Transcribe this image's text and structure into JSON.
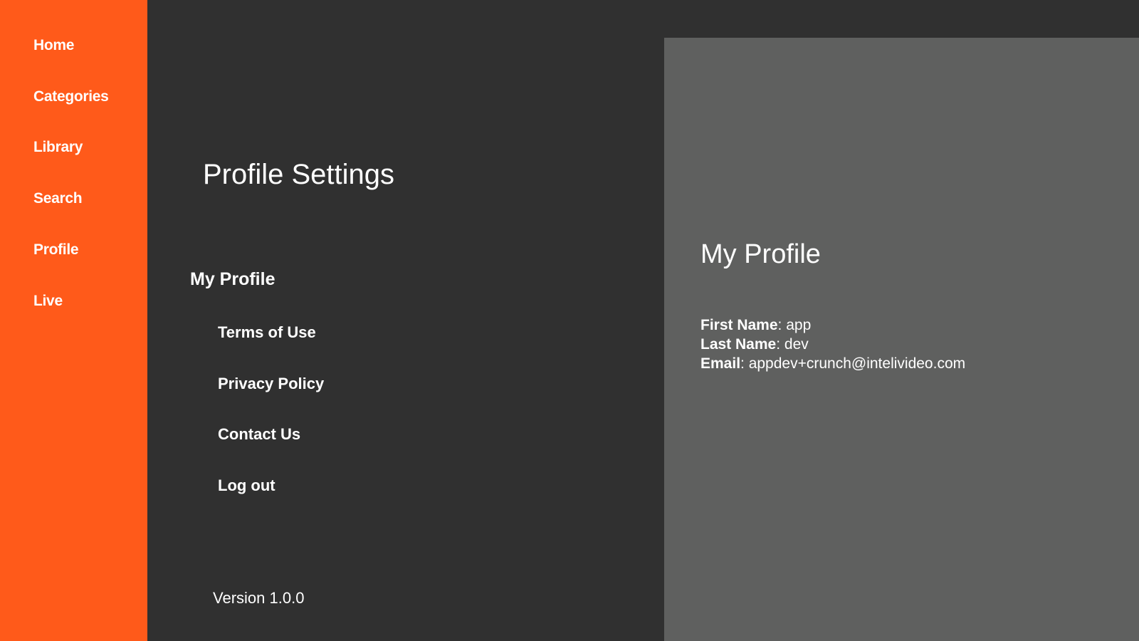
{
  "sidebar": {
    "items": [
      {
        "label": "Home"
      },
      {
        "label": "Categories"
      },
      {
        "label": "Library"
      },
      {
        "label": "Search"
      },
      {
        "label": "Profile"
      },
      {
        "label": "Live"
      }
    ]
  },
  "main": {
    "title": "Profile Settings",
    "menu_heading": "My Profile",
    "menu_items": [
      {
        "label": "Terms of Use"
      },
      {
        "label": "Privacy Policy"
      },
      {
        "label": "Contact Us"
      },
      {
        "label": "Log out"
      }
    ],
    "version": "Version 1.0.0"
  },
  "detail": {
    "title": "My Profile",
    "fields": [
      {
        "label": "First Name",
        "value": "app"
      },
      {
        "label": "Last Name",
        "value": "dev"
      },
      {
        "label": "Email",
        "value": "appdev+crunch@intelivideo.com"
      }
    ]
  },
  "colors": {
    "accent": "#ff5a1a",
    "background": "#303030",
    "panel": "#5f605f"
  }
}
